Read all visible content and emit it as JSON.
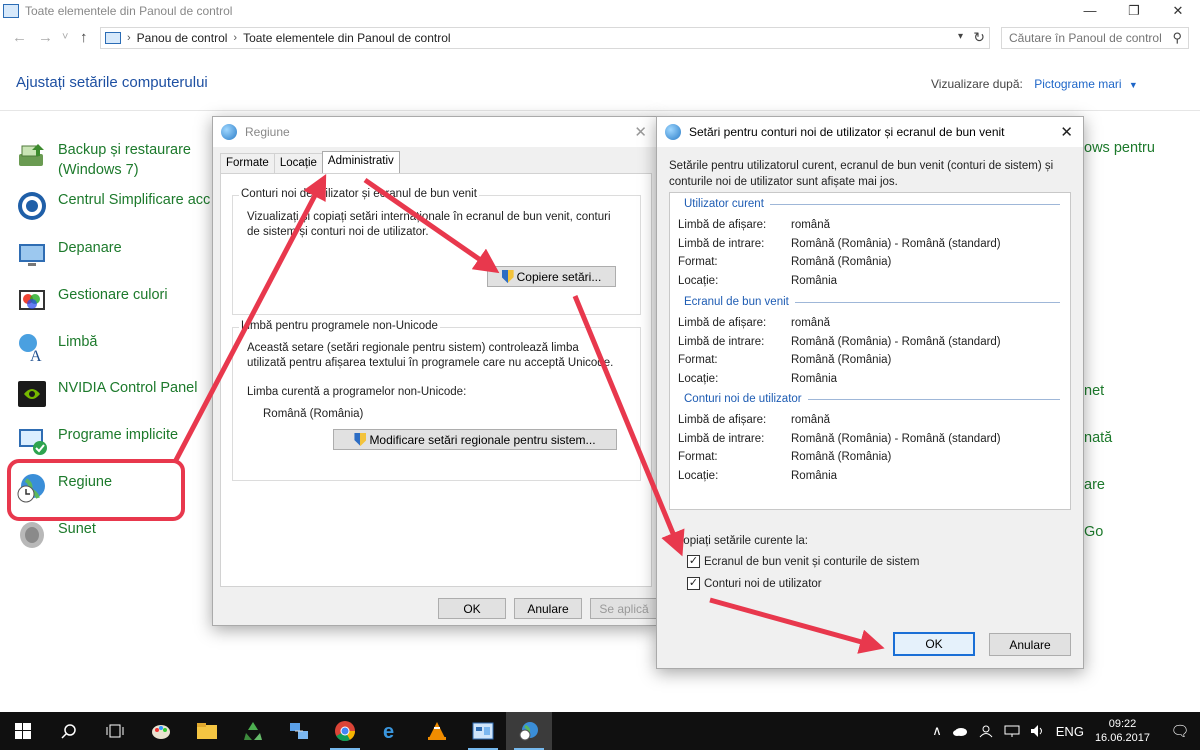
{
  "window": {
    "title": "Toate elementele din Panoul de control",
    "min": "—",
    "max": "❐",
    "close": "✕"
  },
  "nav": {
    "back": "←",
    "forward": "→",
    "recent": "˅",
    "up": "↑"
  },
  "address": {
    "crumbs": [
      "Panou de control",
      "Toate elementele din Panoul de control"
    ],
    "sep": "›",
    "dropdown": "▾",
    "refresh": "↻"
  },
  "search": {
    "placeholder": "Căutare în Panoul de control"
  },
  "heading": "Ajustați setările computerului",
  "view_by": {
    "label": "Vizualizare după:",
    "value": "Pictograme mari",
    "caret": "▼"
  },
  "items": [
    {
      "label": "Backup și restaurare (Windows 7)",
      "icon": "backup-icon"
    },
    {
      "label": "Centrul Simplificare acc",
      "icon": "ease-of-access-icon"
    },
    {
      "label": "Depanare",
      "icon": "troubleshoot-icon"
    },
    {
      "label": "Gestionare culori",
      "icon": "color-management-icon"
    },
    {
      "label": "Limbă",
      "icon": "language-icon"
    },
    {
      "label": "NVIDIA Control Panel",
      "icon": "nvidia-icon"
    },
    {
      "label": "Programe implicite",
      "icon": "default-programs-icon"
    },
    {
      "label": "Regiune",
      "icon": "region-icon"
    },
    {
      "label": "Sunet",
      "icon": "sound-icon"
    }
  ],
  "right_fragments": [
    "ows pentru",
    "net",
    "nată",
    "are",
    "Go"
  ],
  "regiune": {
    "title": "Regiune",
    "close": "✕",
    "tabs": [
      "Formate",
      "Locație",
      "Administrativ"
    ],
    "group1": {
      "legend": "Conturi noi de utilizator și ecranul de bun venit",
      "text": "Vizualizați și copiați setări internaționale în ecranul de bun venit, conturi de sistem și conturi noi de utilizator.",
      "button": "Copiere setări..."
    },
    "group2": {
      "legend": "Limbă pentru programele non-Unicode",
      "text": "Această setare (setări regionale pentru sistem) controlează limba utilizată pentru afișarea textului în programele care nu acceptă Unicode.",
      "current_label": "Limba curentă a programelor non-Unicode:",
      "current_value": "Română (România)",
      "button": "Modificare setări regionale pentru sistem..."
    },
    "ok": "OK",
    "cancel": "Anulare",
    "apply": "Se aplică"
  },
  "setari": {
    "title": "Setări pentru conturi noi de utilizator și ecranul de bun venit",
    "close": "✕",
    "intro": "Setările pentru utilizatorul curent, ecranul de bun venit (conturi de sistem) și conturile noi de utilizator sunt afișate mai jos.",
    "sections": [
      {
        "title": "Utilizator curent",
        "rows": [
          {
            "k": "Limbă de afișare:",
            "v": "română"
          },
          {
            "k": "Limbă de intrare:",
            "v": "Română (România) - Română (standard)"
          },
          {
            "k": "Format:",
            "v": "Română (România)"
          },
          {
            "k": "Locație:",
            "v": "România"
          }
        ]
      },
      {
        "title": "Ecranul de bun venit",
        "rows": [
          {
            "k": "Limbă de afișare:",
            "v": "română"
          },
          {
            "k": "Limbă de intrare:",
            "v": "Română (România) - Română (standard)"
          },
          {
            "k": "Format:",
            "v": "Română (România)"
          },
          {
            "k": "Locație:",
            "v": "România"
          }
        ]
      },
      {
        "title": "Conturi noi de utilizator",
        "rows": [
          {
            "k": "Limbă de afișare:",
            "v": "română"
          },
          {
            "k": "Limbă de intrare:",
            "v": "Română (România) - Română (standard)"
          },
          {
            "k": "Format:",
            "v": "Română (România)"
          },
          {
            "k": "Locație:",
            "v": "România"
          }
        ]
      }
    ],
    "copy_label": "Copiați setările curente la:",
    "checkbox1": "Ecranul de bun venit și conturile de sistem",
    "checkbox2": "Conturi noi de utilizator",
    "checkbox_mark": "✓",
    "ok": "OK",
    "cancel": "Anulare"
  },
  "taskbar": {
    "apps": [
      "start-icon",
      "search-icon",
      "task-view-icon",
      "paint-icon",
      "file-explorer-icon",
      "recycle-icon",
      "network-icon",
      "chrome-icon",
      "edge-icon",
      "vlc-icon",
      "control-panel-icon",
      "region-icon"
    ],
    "tray_up": "∧",
    "lang": "ENG",
    "time": "09:22",
    "date": "16.06.2017",
    "notif": "🗨"
  },
  "colors": {
    "accent": "#1a6fd6",
    "link_green": "#1d7a2c",
    "arrow_red": "#e8384d",
    "taskbar": "#101010"
  }
}
